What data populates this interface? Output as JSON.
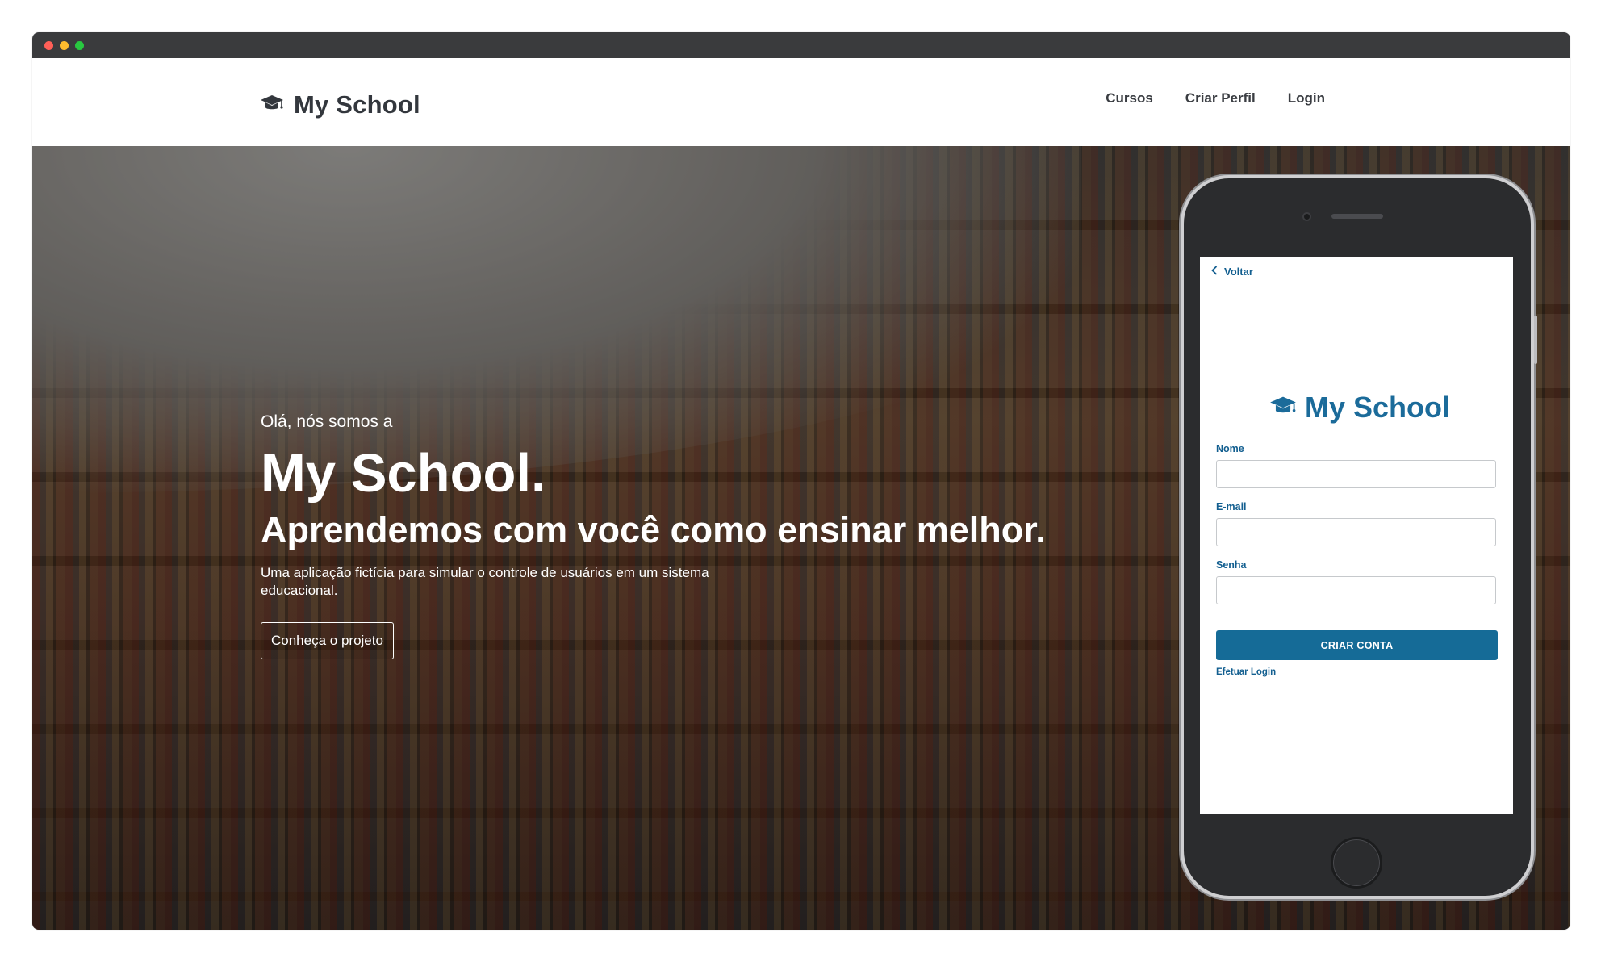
{
  "window": {
    "controls": {
      "close_color": "#ff5f57",
      "minimize_color": "#febc2e",
      "maximize_color": "#28c840"
    },
    "titlebar_color": "#3a3b3d"
  },
  "navbar": {
    "brand": {
      "icon": "graduation-cap-icon",
      "title": "My School"
    },
    "links": [
      "Cursos",
      "Criar Perfil",
      "Login"
    ]
  },
  "hero": {
    "kicker": "Olá, nós somos a",
    "title": "My School.",
    "subtitle": "Aprendemos com você como ensinar melhor.",
    "description": "Uma aplicação fictícia para simular o controle de usuários em um sistema educacional.",
    "cta": "Conheça o projeto"
  },
  "phone": {
    "back_label": "Voltar",
    "brand": {
      "icon": "graduation-cap-icon",
      "title": "My School"
    },
    "form": {
      "fields": [
        {
          "label": "Nome",
          "value": ""
        },
        {
          "label": "E-mail",
          "value": ""
        },
        {
          "label": "Senha",
          "value": ""
        }
      ],
      "submit": "CRIAR CONTA",
      "login_link": "Efetuar Login"
    },
    "accent_color": "#156b97"
  }
}
